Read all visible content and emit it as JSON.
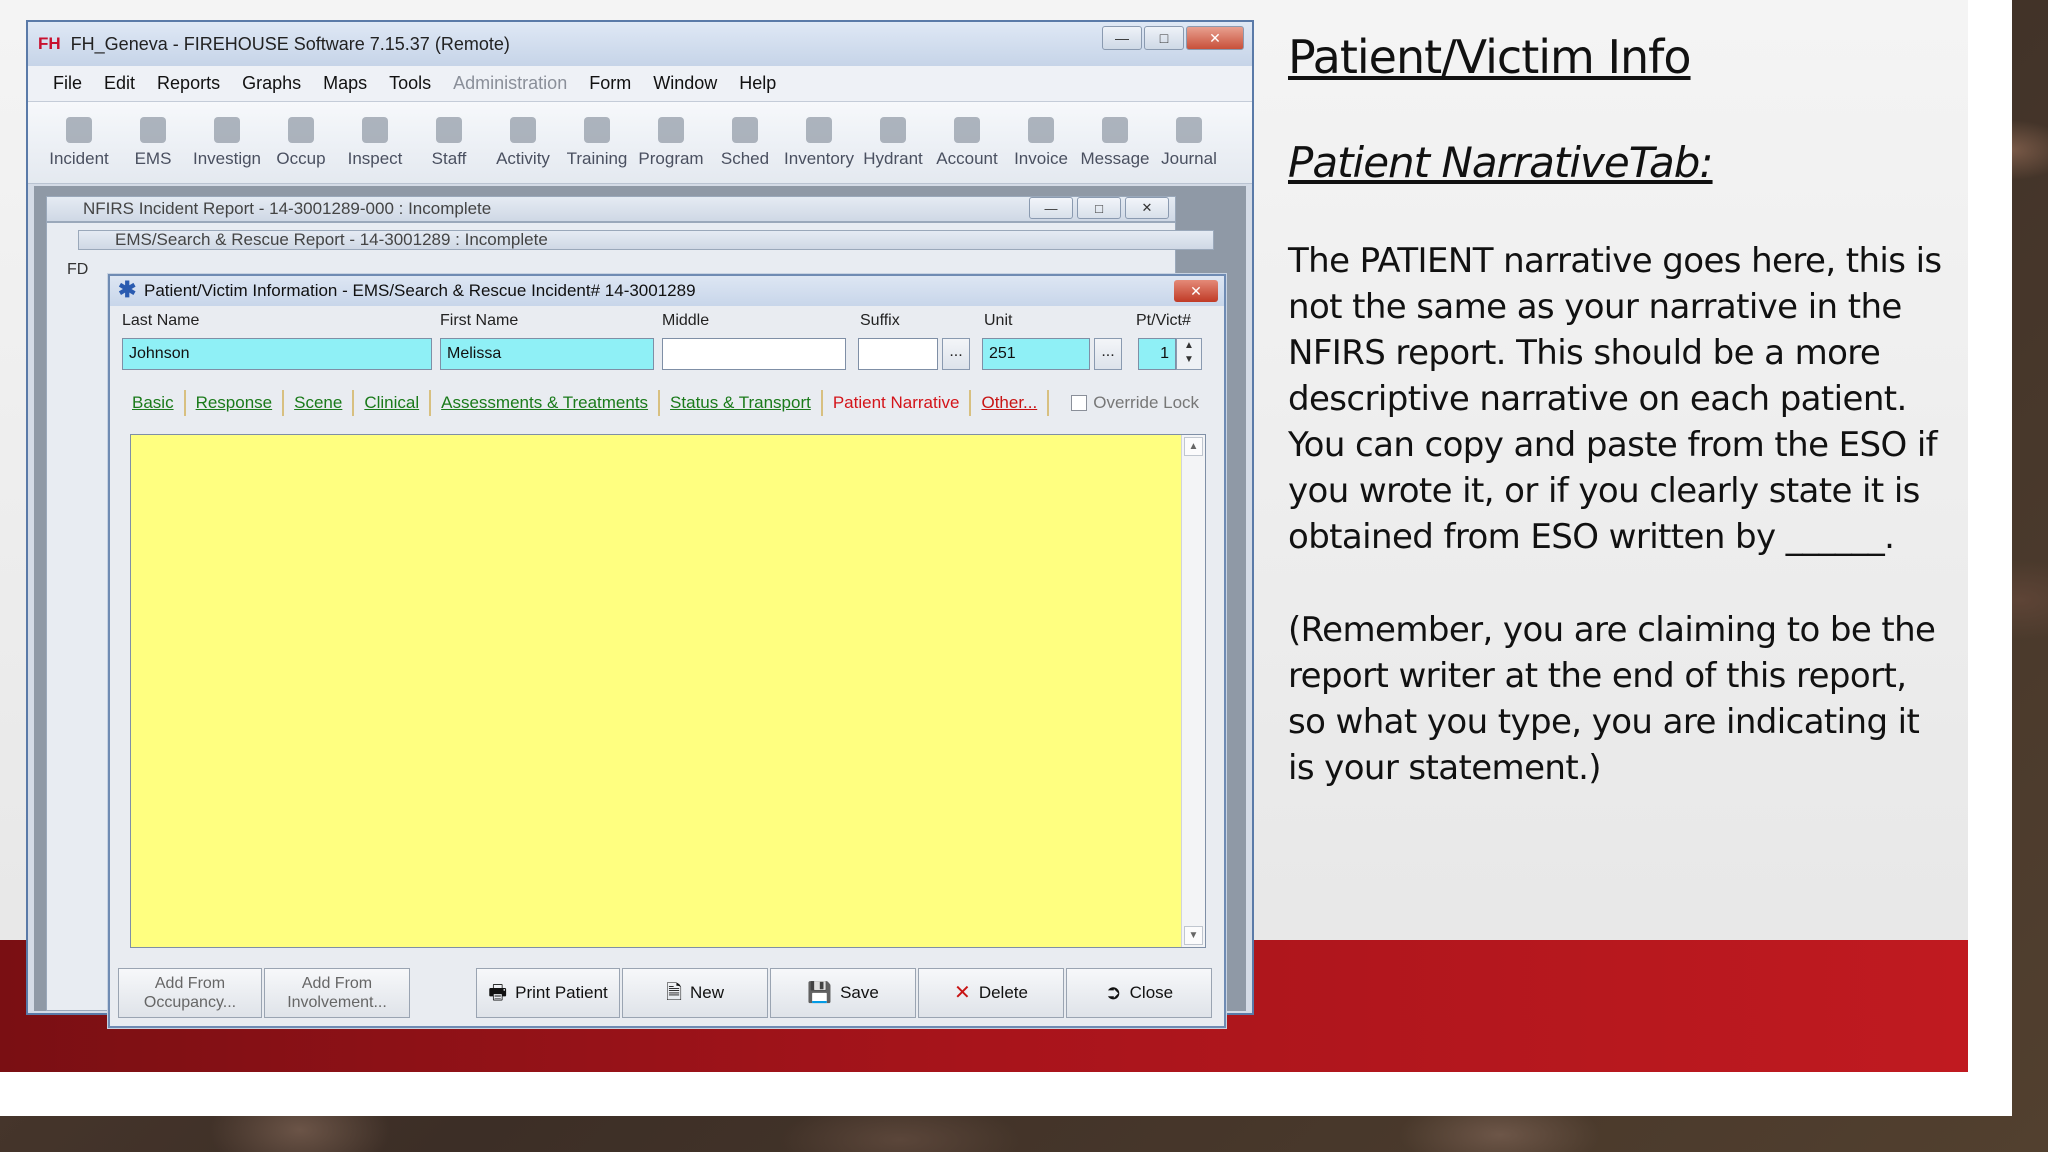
{
  "app": {
    "logo": "FH",
    "title": "FH_Geneva - FIREHOUSE Software 7.15.37 (Remote)",
    "menu": [
      "File",
      "Edit",
      "Reports",
      "Graphs",
      "Maps",
      "Tools",
      "Administration",
      "Form",
      "Window",
      "Help"
    ],
    "toolbar": [
      "Incident",
      "EMS",
      "Investign",
      "Occup",
      "Inspect",
      "Staff",
      "Activity",
      "Training",
      "Program",
      "Sched",
      "Inventory",
      "Hydrant",
      "Account",
      "Invoice",
      "Message",
      "Journal"
    ]
  },
  "nfirs_window": {
    "title": "NFIRS Incident Report  - 14-3001289-000   : Incomplete",
    "fd_label": "FD"
  },
  "ems_window": {
    "title": "EMS/Search & Rescue Report  - 14-3001289   : Incomplete"
  },
  "dialog": {
    "title": "Patient/Victim Information - EMS/Search & Rescue Incident# 14-3001289",
    "labels": {
      "last": "Last Name",
      "first": "First Name",
      "middle": "Middle",
      "suffix": "Suffix",
      "unit": "Unit",
      "ptvict": "Pt/Vict#"
    },
    "values": {
      "last": "Johnson",
      "first": "Melissa",
      "middle": "",
      "suffix": "",
      "unit": "251",
      "ptvict": "1"
    },
    "tabs": [
      "Basic",
      "Response",
      "Scene",
      "Clinical",
      "Assessments & Treatments",
      "Status & Transport",
      "Patient Narrative",
      "Other..."
    ],
    "override_lock": "Override Lock",
    "narrative": "",
    "buttons": {
      "add_occ_1": "Add From",
      "add_occ_2": "Occupancy...",
      "add_inv_1": "Add From",
      "add_inv_2": "Involvement...",
      "print": "Print Patient",
      "new": "New",
      "save": "Save",
      "delete": "Delete",
      "close": "Close"
    }
  },
  "slide": {
    "title": "Patient/Victim Info",
    "subtitle": "Patient NarrativeTab:",
    "para1": "The PATIENT narrative goes here, this is not the same as your narrative in the NFIRS report.  This should be a more descriptive narrative on each patient.  You can copy and paste from the ESO if you wrote it, or if you clearly state it is obtained from ESO written by ______.",
    "para2": "(Remember, you are claiming to be the report writer at the end of this report, so what you type, you are indicating it is your statement.)"
  }
}
